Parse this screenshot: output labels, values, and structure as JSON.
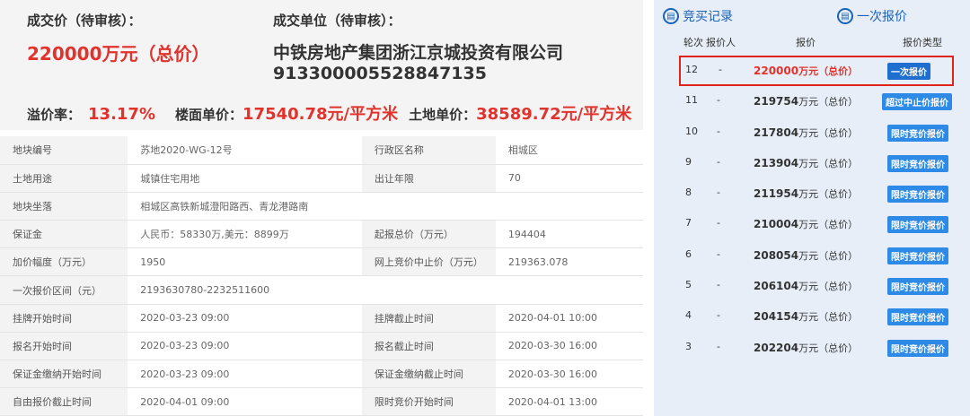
{
  "summary": {
    "deal_price_label": "成交价（待审核）：",
    "deal_price_value": "220000万元（总价）",
    "deal_unit_label": "成交单位（待审核）：",
    "deal_unit_name": "中铁房地产集团浙江京城投资有限公司",
    "deal_unit_code": "91330000552884713​5",
    "premium_label": "溢价率：",
    "premium_value": "13.17%",
    "floor_price_label": "楼面单价：",
    "floor_price_value": "17540.78元/平方米",
    "land_price_label": "土地单价：",
    "land_price_value": "38589.72元/平方米"
  },
  "info_table": [
    [
      "地块编号",
      "苏地2020-WG-12号",
      "行政区名称",
      "相城区"
    ],
    [
      "土地用途",
      "城镇住宅用地",
      "出让年限",
      "70"
    ],
    [
      "地块坐落",
      "相城区高铁新城澄阳路西、青龙港路南",
      "",
      ""
    ],
    [
      "保证金",
      "人民币：58330万,美元：8899万",
      "起报总价（万元）",
      "194404"
    ],
    [
      "加价幅度（万元）",
      "1950",
      "网上竞价中止价（万元）",
      "219363.078"
    ],
    [
      "一次报价区间（元）",
      "2193630780-2232511600",
      "",
      ""
    ],
    [
      "挂牌开始时间",
      "2020-03-23 09:00",
      "挂牌截止时间",
      "2020-04-01 10:00"
    ],
    [
      "报名开始时间",
      "2020-03-23 09:00",
      "报名截止时间",
      "2020-03-30 16:00"
    ],
    [
      "保证金缴纳开始时间",
      "2020-03-23 09:00",
      "保证金缴纳截止时间",
      "2020-03-30 16:00"
    ],
    [
      "自由报价截止时间",
      "2020-04-01 09:00",
      "限时竞价开始时间",
      "2020-04-01 13:00"
    ]
  ],
  "panel": {
    "tab_records": "竞买记录",
    "tab_once": "一次报价",
    "tab_icon": "document-icon",
    "headers": {
      "round": "轮次",
      "bidder": "报价人",
      "price": "报价",
      "type": "报价类型"
    },
    "bids": [
      {
        "round": "12",
        "bidder": "-",
        "amount": "220000",
        "unit": "万元（总价）",
        "type": "一次报价"
      },
      {
        "round": "11",
        "bidder": "-",
        "amount": "219754",
        "unit": "万元（总价）",
        "type": "超过中止价报价"
      },
      {
        "round": "10",
        "bidder": "-",
        "amount": "217804",
        "unit": "万元（总价）",
        "type": "限时竞价报价"
      },
      {
        "round": "9",
        "bidder": "-",
        "amount": "213904",
        "unit": "万元（总价）",
        "type": "限时竞价报价"
      },
      {
        "round": "8",
        "bidder": "-",
        "amount": "211954",
        "unit": "万元（总价）",
        "type": "限时竞价报价"
      },
      {
        "round": "7",
        "bidder": "-",
        "amount": "210004",
        "unit": "万元（总价）",
        "type": "限时竞价报价"
      },
      {
        "round": "6",
        "bidder": "-",
        "amount": "208054",
        "unit": "万元（总价）",
        "type": "限时竞价报价"
      },
      {
        "round": "5",
        "bidder": "-",
        "amount": "206104",
        "unit": "万元（总价）",
        "type": "限时竞价报价"
      },
      {
        "round": "4",
        "bidder": "-",
        "amount": "204154",
        "unit": "万元（总价）",
        "type": "限时竞价报价"
      },
      {
        "round": "3",
        "bidder": "-",
        "amount": "202204",
        "unit": "万元（总价）",
        "type": "限时竞价报价"
      }
    ]
  },
  "colors": {
    "accent_red": "#e1322c",
    "accent_blue": "#1a63b6",
    "badge_blue": "#2d8ae6",
    "panel_bg": "#e7eef7"
  }
}
